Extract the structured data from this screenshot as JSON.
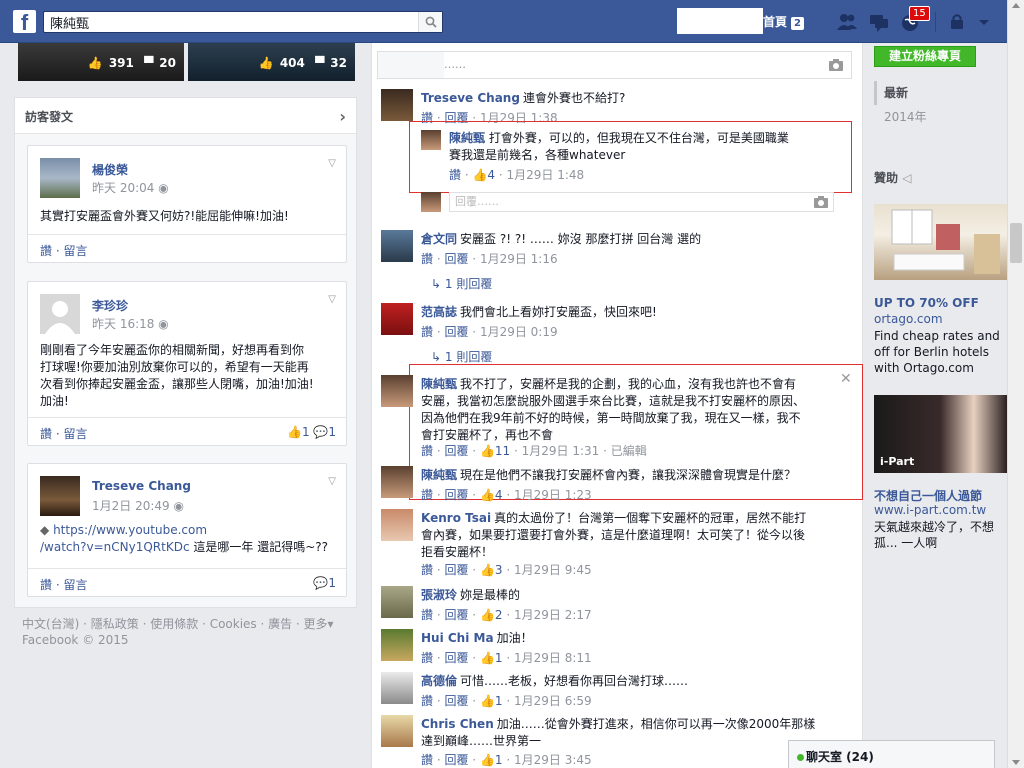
{
  "topbar": {
    "logo": "f",
    "search_value": "陳純甄",
    "home_label": "首頁",
    "home_count": "2",
    "notifications_count": "15",
    "colors": {
      "bar": "#3b5998",
      "badge": "#dc0a0a"
    }
  },
  "photos": [
    {
      "likes": "391",
      "comments": "20"
    },
    {
      "likes": "404",
      "comments": "32"
    }
  ],
  "visitor": {
    "header": "訪客發文",
    "posts": [
      {
        "name": "楊俊榮",
        "time": "昨天 20:04",
        "body": "其實打安麗盃會外賽又何妨?!能屈能伸嘛!加油!",
        "like": "讚",
        "comment": "留言"
      },
      {
        "name": "李珍珍",
        "time": "昨天 16:18",
        "body_lines": [
          "剛剛看了今年安麗盃你的相關新聞，好想再看到你",
          "打球喔!你要加油別放棄你可以的，希望有一天能再",
          "次看到你捧起安麗金盃，讓那些人閉嘴，加油!加油!",
          "加油!"
        ],
        "like": "讚",
        "comment": "留言",
        "likes_count": "1",
        "comments_count": "1"
      },
      {
        "name": "Treseve Chang",
        "time": "1月2日 20:49",
        "link_line1": "https://www.youtube.com",
        "link_line2": "/watch?v=nCNy1QRtKDc",
        "body_after": "這是哪一年 還記得嗎~??",
        "like": "讚",
        "comment": "留言",
        "comments_count": "1"
      }
    ]
  },
  "footer": {
    "line1": "中文(台灣) · 隱私政策 · 使用條款 · Cookies · 廣告 · 更多▾",
    "line2": "Facebook © 2015"
  },
  "comments": {
    "top_reply_placeholder": "……",
    "reply_placeholder": "回覆……",
    "like": "讚",
    "reply": "回覆",
    "items": [
      {
        "name": "Treseve Chang",
        "text": "連會外賽也不給打?",
        "time": "1月29日 1:38"
      },
      {
        "name": "陳純甄",
        "text_line1": "打會外賽，可以的，但我現在又不住台灣，可是美國職業",
        "text_line2": "賽我還是前幾名，各種whatever",
        "likes": "4",
        "time": "1月29日 1:48"
      },
      {
        "name": "倉文同",
        "text": "安麗盃 ?! ?! …… 妳沒 那麼打拼 回台灣 選的",
        "time": "1月29日 1:16",
        "more": "1 則回覆"
      },
      {
        "name": "范高誌",
        "text": "我們會北上看妳打安麗盃，快回來吧!",
        "time": "1月29日 0:19",
        "more": "1 則回覆"
      },
      {
        "name": "陳純甄",
        "text_lines": [
          "我不打了，安麗杯是我的企劃，我的心血，沒有我也許也不會有",
          "安麗，我當初怎麼說服外國選手來台比賽，這就是我不打安麗杯的原因、",
          "因為他們在我9年前不好的時候，第一時間放棄了我，現在又一樣，我不",
          "會打安麗杯了，再也不會"
        ],
        "likes": "11",
        "time": "1月29日 1:31",
        "edited": "已編輯"
      },
      {
        "name": "陳純甄",
        "text": "現在是他們不讓我打安麗杯會內賽，讓我深深體會現實是什麼？",
        "likes": "4",
        "time": "1月29日 1:23"
      },
      {
        "name": "Kenro Tsai",
        "text_lines": [
          "真的太過份了！台灣第一個奪下安麗杯的冠軍，居然不能打",
          "會內賽，如果要打還要打會外賽，這是什麼道理啊！太可笑了！從今以後",
          "拒看安麗杯！"
        ],
        "likes": "3",
        "time": "1月29日 9:45"
      },
      {
        "name": "張淑玲",
        "text": "妳是最棒的",
        "likes": "2",
        "time": "1月29日 2:17"
      },
      {
        "name": "Hui Chi Ma",
        "text": "加油！",
        "likes": "1",
        "time": "1月29日 8:11"
      },
      {
        "name": "高德倫",
        "text": "可惜……老板，好想看你再回台灣打球……",
        "likes": "1",
        "time": "1月29日 6:59"
      },
      {
        "name": "Chris Chen",
        "text_lines": [
          "加油……從會外賽打進來，相信你可以再一次像2000年那樣",
          "達到巔峰……世界第一"
        ],
        "likes": "1",
        "time": "1月29日 3:45"
      }
    ]
  },
  "right": {
    "create_page": "建立粉絲專頁",
    "timeline": [
      "最新",
      "2014年"
    ],
    "sponsored": "贊助",
    "ads": [
      {
        "title": "UP TO 70% OFF",
        "url": "ortago.com",
        "body": "Find cheap rates and off for Berlin hotels with Ortago.com"
      },
      {
        "title": "不想自己一個人過節",
        "url": "www.i-part.com.tw",
        "body": "天氣越來越冷了，不想孤... 一人啊",
        "brand": "i-Part"
      }
    ]
  },
  "chat": {
    "label": "聊天室 (24)"
  }
}
